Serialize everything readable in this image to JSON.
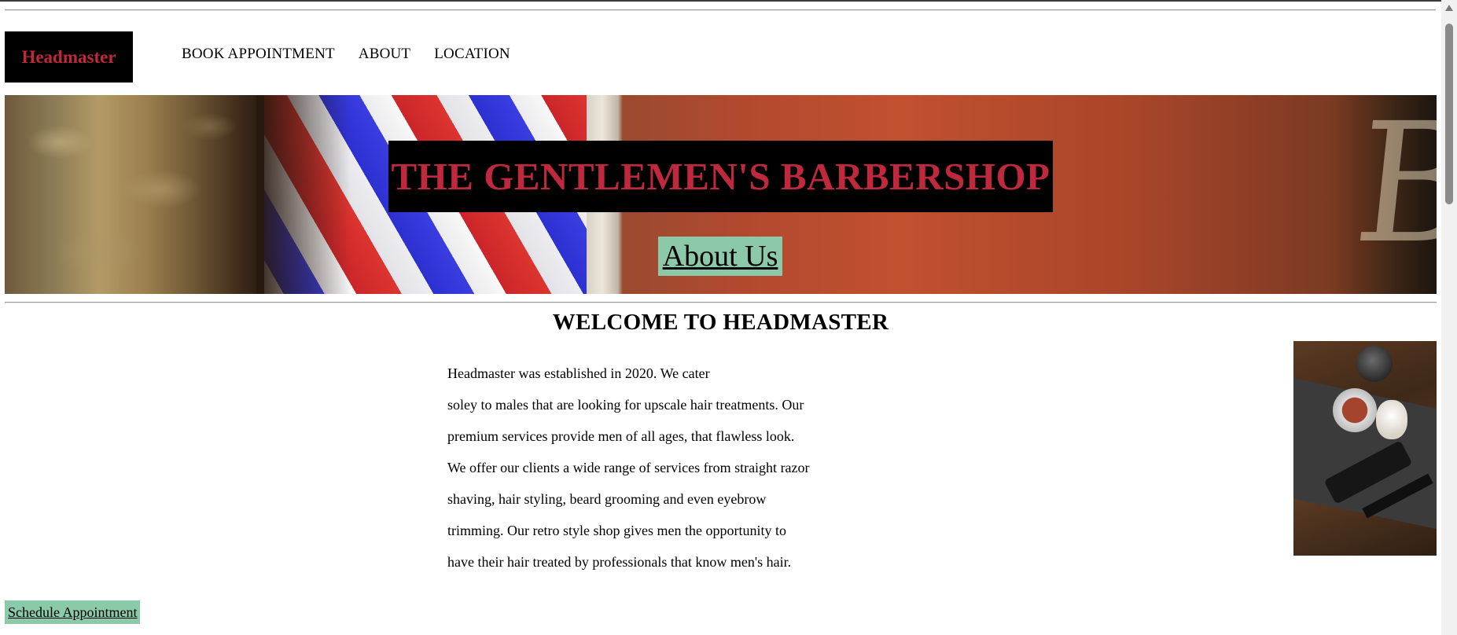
{
  "header": {
    "logo": "Headmaster",
    "nav": [
      "BOOK APPOINTMENT",
      "ABOUT",
      "LOCATION"
    ]
  },
  "hero": {
    "title": "THE GENTLEMEN'S BARBERSHOP",
    "about_link": "About Us",
    "sign_text": "Barber Shop"
  },
  "main": {
    "heading": "WELCOME TO HEADMASTER",
    "paragraph_lines": [
      "Headmaster was established in 2020. We cater",
      "soley to males that are looking for upscale hair treatments. Our",
      "premium services provide men of all ages, that flawless look.",
      "We offer our clients a wide range of services from straight razor",
      "shaving, hair styling, beard grooming and even eyebrow",
      "trimming. Our retro style shop gives men the opportunity to",
      "have their hair treated by professionals that know men's hair."
    ],
    "schedule_link": "Schedule Appointment"
  },
  "colors": {
    "brand_red": "#c0283d",
    "accent_green": "#8bc9a9",
    "black": "#000000"
  },
  "icons": {
    "scroll_up": "chevron-up-icon"
  }
}
